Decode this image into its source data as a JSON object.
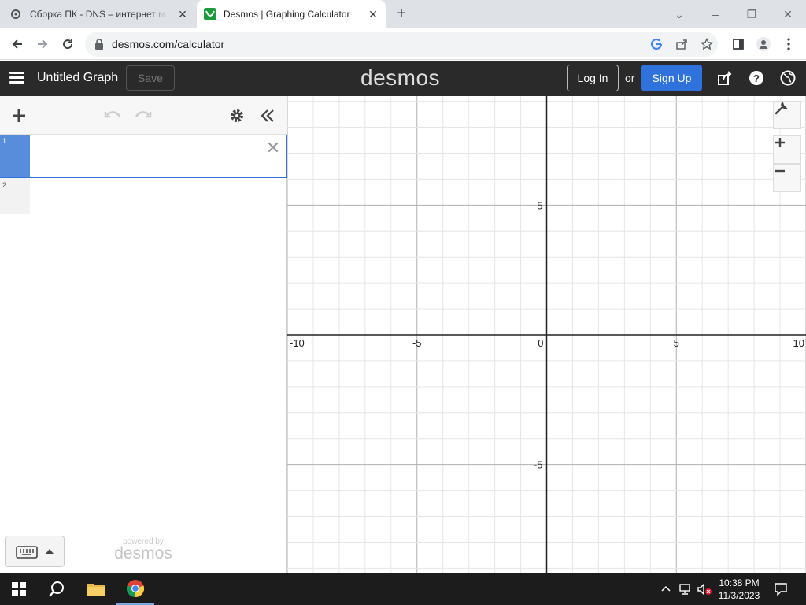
{
  "browser": {
    "tabs": [
      {
        "title": "Сборка ПК - DNS – интернет магазин",
        "active": false
      },
      {
        "title": "Desmos | Graphing Calculator",
        "active": true
      }
    ],
    "url": "desmos.com/calculator"
  },
  "header": {
    "graph_title": "Untitled Graph",
    "save_label": "Save",
    "logo": "desmos",
    "login_label": "Log In",
    "or_text": "or",
    "signup_label": "Sign Up",
    "accent_color": "#2f72dc"
  },
  "expressions": {
    "rows": [
      {
        "index": "1",
        "value": ""
      },
      {
        "index": "2",
        "value": ""
      }
    ],
    "powered_by_small": "powered by",
    "powered_by_logo": "desmos"
  },
  "graph": {
    "x_ticks": [
      "-10",
      "-5",
      "0",
      "5",
      "10"
    ],
    "y_ticks": [
      "5",
      "-5"
    ],
    "x_range": [
      -10,
      10
    ],
    "y_range": [
      -9.2,
      9.2
    ]
  },
  "taskbar": {
    "time": "10:38 PM",
    "date": "11/3/2023"
  }
}
